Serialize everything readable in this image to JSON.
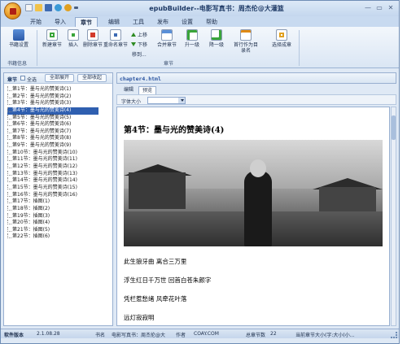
{
  "window": {
    "title": "epubBuilder--电影写真书：周杰伦@大灌篮",
    "controls": [
      "minimize",
      "restore",
      "close"
    ]
  },
  "ribbon_tabs": [
    "开始",
    "导入",
    "章节",
    "编辑",
    "工具",
    "发布",
    "设置",
    "帮助"
  ],
  "active_tab": "章节",
  "ribbon": {
    "group1": {
      "buttons": [
        {
          "label": "书籍设置",
          "icon": "book-settings-icon"
        }
      ],
      "label": "书籍信息"
    },
    "group2": {
      "buttons": [
        {
          "label": "新建章节",
          "icon": "new-chapter-icon"
        },
        {
          "label": "插入",
          "icon": "insert-icon"
        },
        {
          "label": "删除章节",
          "icon": "delete-chapter-icon"
        },
        {
          "label": "重命名章节",
          "icon": "rename-chapter-icon"
        }
      ],
      "small": [
        {
          "label": "上移"
        },
        {
          "label": "下移"
        },
        {
          "label": "移到..."
        }
      ],
      "more": [
        {
          "label": "合并章节",
          "icon": "merge-icon"
        },
        {
          "label": "升一级",
          "icon": "promote-icon"
        },
        {
          "label": "降一级",
          "icon": "demote-icon"
        },
        {
          "label": "首行作为目录名",
          "icon": "first-line-toc-icon"
        },
        {
          "label": "选择成章",
          "icon": "select-as-chapter-icon"
        }
      ],
      "label": "章节"
    }
  },
  "left_panel": {
    "title": "章节",
    "select_all": "全选",
    "expand_all": "全部展开",
    "collapse_all": "全部收起",
    "chapters": [
      "第1节：墨与光的赞美诗(1)",
      "第2节：墨与光的赞美诗(2)",
      "第3节：墨与光的赞美诗(3)",
      "第4节：墨与光的赞美诗(4)",
      "第5节：墨与光的赞美诗(5)",
      "第6节：墨与光的赞美诗(6)",
      "第7节：墨与光的赞美诗(7)",
      "第8节：墨与光的赞美诗(8)",
      "第9节：墨与光的赞美诗(9)",
      "第10节：墨与光的赞美诗(10)",
      "第11节：墨与光的赞美诗(11)",
      "第12节：墨与光的赞美诗(12)",
      "第13节：墨与光的赞美诗(13)",
      "第14节：墨与光的赞美诗(14)",
      "第15节：墨与光的赞美诗(15)",
      "第16节：墨与光的赞美诗(16)",
      "第17节：插图(1)",
      "第18节：插图(2)",
      "第19节：插图(3)",
      "第20节：插图(4)",
      "第21节：插图(5)",
      "第22节：插图(6)"
    ],
    "selected_index": 3
  },
  "editor": {
    "file_name": "chapter4.html",
    "subtabs": [
      "编辑",
      "预览"
    ],
    "active_subtab": "预览",
    "font_size_label": "字体大小",
    "chapter_heading": "第4节：墨与光的赞美诗(4)",
    "poem_lines": [
      "此生狼牙曲  离合三万里",
      "浮生红日千万世  回首白苍朱颜字",
      "凭栏惹愁绪  风牵花叶落",
      "远灯寂寂明"
    ]
  },
  "status_bar": {
    "version_label": "软件版本",
    "version": "2.1.08.28",
    "book_label": "书名",
    "book_name": "电影写真书：周杰伦@大",
    "author_label": "作者",
    "author": "COAY.COM",
    "chapter_count_label": "总章节数",
    "chapter_count": "22",
    "current_size_label": "当前章节大小(字:大小(小..."
  }
}
